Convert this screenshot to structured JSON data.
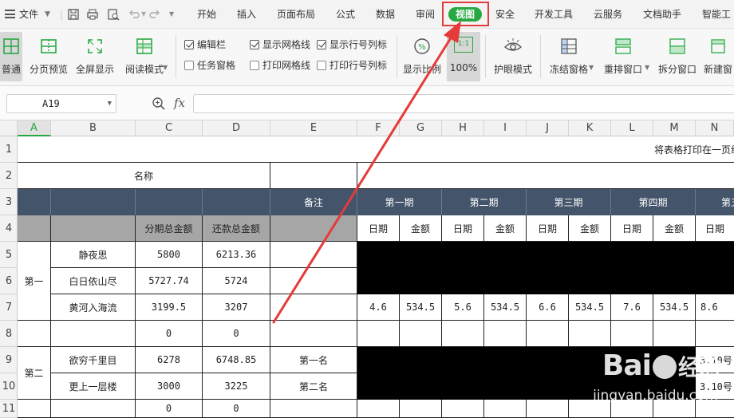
{
  "menu": {
    "file_label": "文件",
    "tabs": [
      "开始",
      "插入",
      "页面布局",
      "公式",
      "数据",
      "审阅",
      "视图",
      "安全",
      "开发工具",
      "云服务",
      "文档助手",
      "智能工"
    ],
    "active_tab": "视图"
  },
  "ribbon": {
    "normal": "普通",
    "page_break_preview": "分页预览",
    "fullscreen": "全屏显示",
    "reading_mode": "阅读模式",
    "edit_bar": "编辑栏",
    "task_pane": "任务窗格",
    "show_gridlines": "显示网格线",
    "print_gridlines": "打印网格线",
    "show_headers": "显示行号列标",
    "print_headers": "打印行号列标",
    "zoom": "显示比例",
    "zoom_100": "100%",
    "zoom_icon_text": "1:1",
    "eye_mode": "护眼模式",
    "freeze": "冻结窗格",
    "rearrange": "重排窗口",
    "split": "拆分窗口",
    "new_window": "新建窗"
  },
  "formula_bar": {
    "cell_ref": "A19",
    "fx": "fx",
    "value": ""
  },
  "sheet": {
    "columns": [
      "A",
      "B",
      "C",
      "D",
      "E",
      "F",
      "G",
      "H",
      "I",
      "J",
      "K",
      "L",
      "M",
      "N"
    ],
    "rows": [
      "1",
      "2",
      "3",
      "4",
      "5",
      "6",
      "7",
      "8",
      "9",
      "10",
      "11"
    ],
    "selected_col": "A",
    "title": "将表格打印在一页纸",
    "name_header": "名称",
    "remark_header": "备注",
    "periods": [
      "第一期",
      "第二期",
      "第三期",
      "第四期",
      "第五"
    ],
    "sub_headers": {
      "installment_total": "分期总金额",
      "repay_total": "还款总金额",
      "date": "日期",
      "amount": "金额"
    },
    "groups": [
      "第一",
      "第二"
    ],
    "data_rows": [
      {
        "name": "静夜思",
        "c": "5800",
        "d": "6213.36",
        "e": ""
      },
      {
        "name": "白日依山尽",
        "c": "5727.74",
        "d": "5724",
        "e": ""
      },
      {
        "name": "黄河入海流",
        "c": "3199.5",
        "d": "3207",
        "e": ""
      },
      {
        "name": "",
        "c": "0",
        "d": "0",
        "e": ""
      },
      {
        "name": "欲穷千里目",
        "c": "6278",
        "d": "6748.85",
        "e": "第一名"
      },
      {
        "name": "更上一层楼",
        "c": "3000",
        "d": "3225",
        "e": "第二名"
      },
      {
        "name": "",
        "c": "0",
        "d": "0",
        "e": ""
      }
    ],
    "row7_values": [
      "4.6",
      "534.5",
      "5.6",
      "534.5",
      "6.6",
      "534.5",
      "7.6",
      "534.5",
      "8.6"
    ],
    "n_col_values": [
      "3.10号",
      "3.10号"
    ]
  },
  "watermark": {
    "brand": "Bai",
    "brand2": "经验",
    "url": "jingyan.baidu.com"
  },
  "colors": {
    "accent": "#27a843",
    "header_bg": "#44546a",
    "subheader_bg": "#a6a6a6",
    "annotation": "#e53b3b"
  }
}
